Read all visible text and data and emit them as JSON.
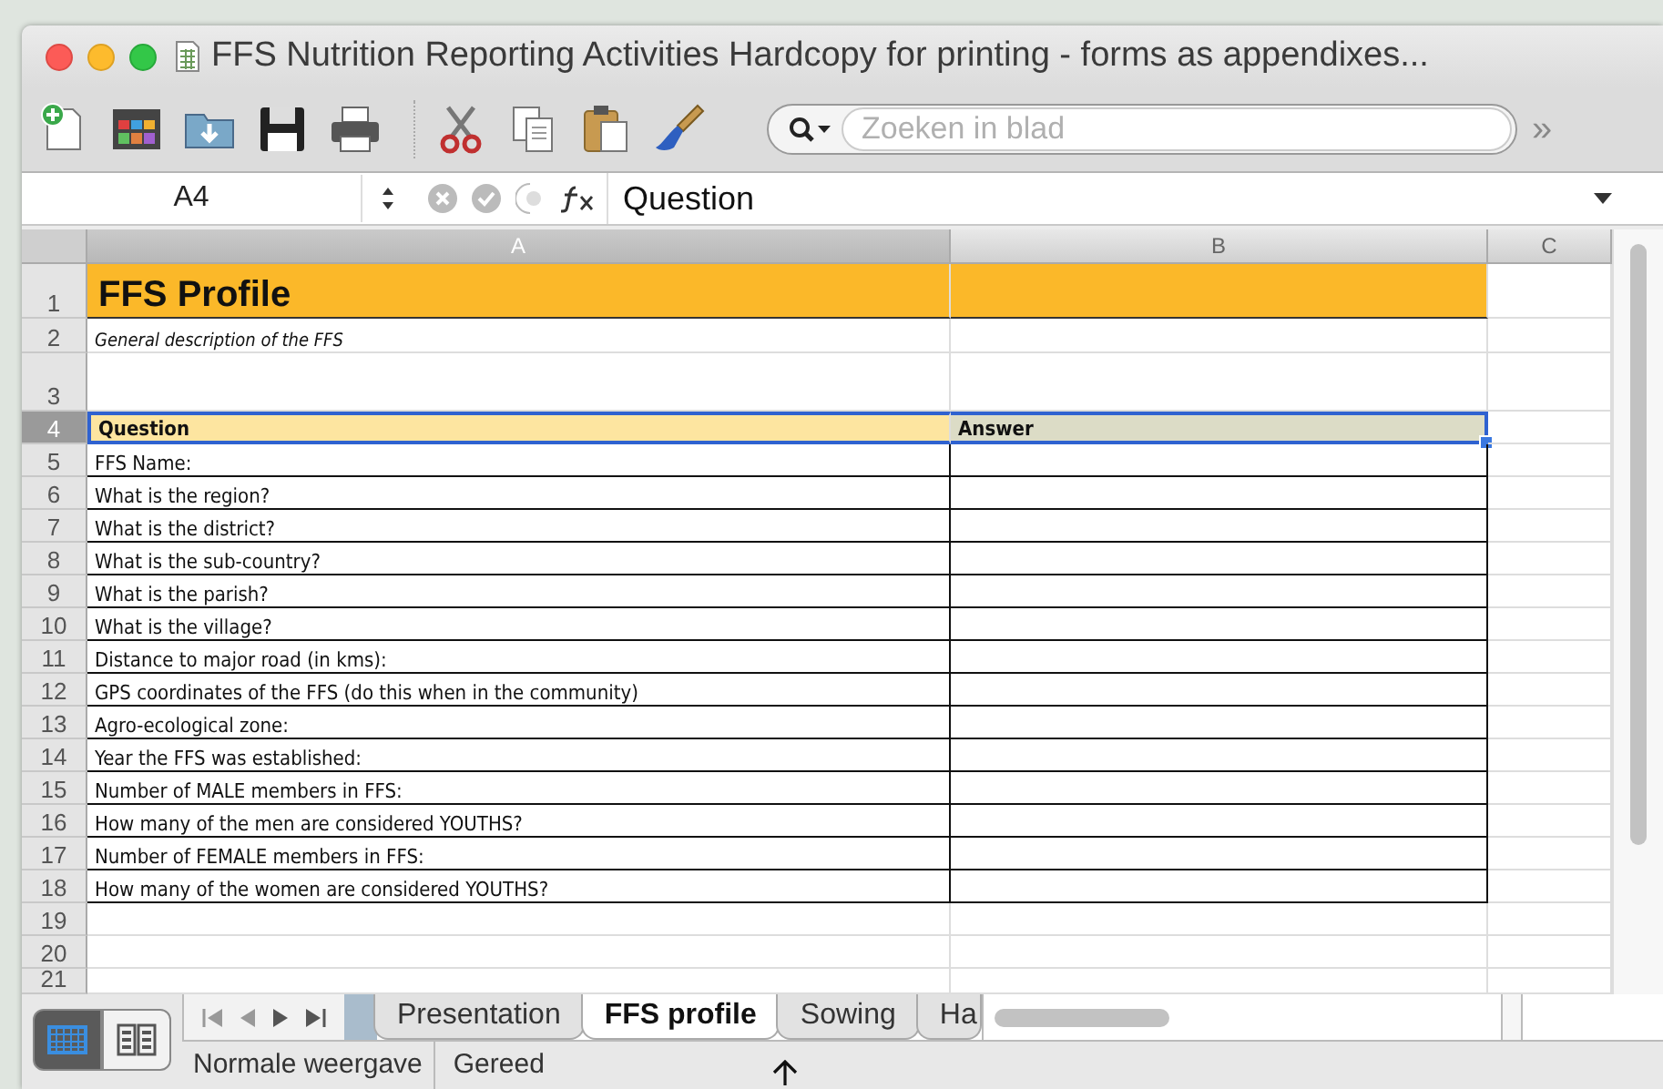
{
  "window": {
    "title": "FFS Nutrition Reporting Activities Hardcopy for printing - forms as appendixes..."
  },
  "toolbar": {
    "search": {
      "placeholder": "Zoeken in blad"
    },
    "overflow": "»"
  },
  "formula_bar": {
    "cell_ref": "A4",
    "formula": "Question"
  },
  "sheet": {
    "columns": [
      {
        "label": "A",
        "selected": true
      },
      {
        "label": "B",
        "selected": false
      },
      {
        "label": "C",
        "selected": false
      }
    ],
    "rows": [
      {
        "number": "1",
        "kind": "title",
        "selected": false,
        "cells": [
          "FFS Profile"
        ]
      },
      {
        "number": "2",
        "kind": "note",
        "selected": false,
        "cells": [
          "General description of the FFS"
        ]
      },
      {
        "number": "3",
        "kind": "blank",
        "selected": false,
        "cells": []
      },
      {
        "number": "4",
        "kind": "header",
        "selected": true,
        "cells": [
          "Question",
          "Answer"
        ]
      },
      {
        "number": "5",
        "kind": "question",
        "selected": false,
        "cells": [
          "FFS Name:"
        ]
      },
      {
        "number": "6",
        "kind": "question",
        "selected": false,
        "cells": [
          "What is the region?"
        ]
      },
      {
        "number": "7",
        "kind": "question",
        "selected": false,
        "cells": [
          "What is the district?"
        ]
      },
      {
        "number": "8",
        "kind": "question",
        "selected": false,
        "cells": [
          "What is the sub-country?"
        ]
      },
      {
        "number": "9",
        "kind": "question",
        "selected": false,
        "cells": [
          "What is the parish?"
        ]
      },
      {
        "number": "10",
        "kind": "question",
        "selected": false,
        "cells": [
          "What is the village?"
        ]
      },
      {
        "number": "11",
        "kind": "question",
        "selected": false,
        "cells": [
          "Distance to major road (in kms):"
        ]
      },
      {
        "number": "12",
        "kind": "question",
        "selected": false,
        "cells": [
          "GPS coordinates of the FFS (do this when in the community)"
        ]
      },
      {
        "number": "13",
        "kind": "question",
        "selected": false,
        "cells": [
          "Agro-ecological zone:"
        ]
      },
      {
        "number": "14",
        "kind": "question",
        "selected": false,
        "cells": [
          "Year the FFS was established:"
        ]
      },
      {
        "number": "15",
        "kind": "question",
        "selected": false,
        "cells": [
          "Number of MALE members in FFS:"
        ]
      },
      {
        "number": "16",
        "kind": "question",
        "selected": false,
        "cells": [
          "How many of the men are considered YOUTHS?"
        ]
      },
      {
        "number": "17",
        "kind": "question",
        "selected": false,
        "cells": [
          "Number of FEMALE members in FFS:"
        ]
      },
      {
        "number": "18",
        "kind": "question",
        "selected": false,
        "cells": [
          "How many of the women are considered YOUTHS?"
        ]
      },
      {
        "number": "19",
        "kind": "blank",
        "selected": false,
        "cells": []
      },
      {
        "number": "20",
        "kind": "blank",
        "selected": false,
        "cells": []
      },
      {
        "number": "21",
        "kind": "partial",
        "selected": false,
        "cells": []
      }
    ]
  },
  "view_buttons": [
    {
      "kind": "normal",
      "selected": true
    },
    {
      "kind": "layout",
      "selected": false
    }
  ],
  "sheet_tabs": [
    {
      "label": "Presentation",
      "selected": false
    },
    {
      "label": "FFS profile",
      "selected": true
    },
    {
      "label": "Sowing",
      "selected": false
    },
    {
      "label": "Ha",
      "selected": false
    }
  ],
  "status_bar": {
    "view": "Normale weergave",
    "state": "Gereed"
  }
}
